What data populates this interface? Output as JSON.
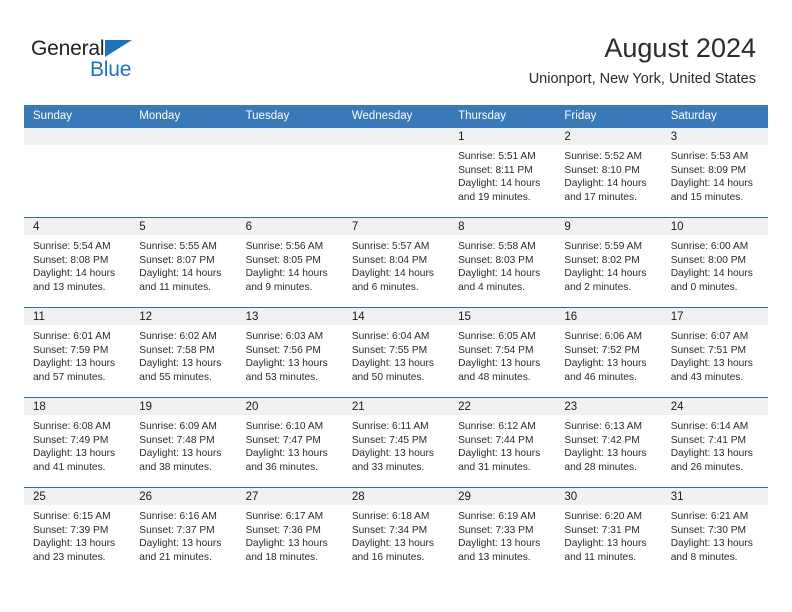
{
  "brand": {
    "name_top": "General",
    "name_bottom": "Blue",
    "triangle_color": "#1f72bd"
  },
  "header": {
    "title": "August 2024",
    "subtitle": "Unionport, New York, United States"
  },
  "theme": {
    "header_blue": "#3a79b8",
    "separator_blue": "#2e6da4",
    "daynum_band": "#f1f1f1"
  },
  "calendar": {
    "weekday_headers": [
      "Sunday",
      "Monday",
      "Tuesday",
      "Wednesday",
      "Thursday",
      "Friday",
      "Saturday"
    ],
    "weeks": [
      [
        {
          "day": "",
          "sunrise": "",
          "sunset": "",
          "daylight_line1": "",
          "daylight_line2": ""
        },
        {
          "day": "",
          "sunrise": "",
          "sunset": "",
          "daylight_line1": "",
          "daylight_line2": ""
        },
        {
          "day": "",
          "sunrise": "",
          "sunset": "",
          "daylight_line1": "",
          "daylight_line2": ""
        },
        {
          "day": "",
          "sunrise": "",
          "sunset": "",
          "daylight_line1": "",
          "daylight_line2": ""
        },
        {
          "day": "1",
          "sunrise": "Sunrise: 5:51 AM",
          "sunset": "Sunset: 8:11 PM",
          "daylight_line1": "Daylight: 14 hours",
          "daylight_line2": "and 19 minutes."
        },
        {
          "day": "2",
          "sunrise": "Sunrise: 5:52 AM",
          "sunset": "Sunset: 8:10 PM",
          "daylight_line1": "Daylight: 14 hours",
          "daylight_line2": "and 17 minutes."
        },
        {
          "day": "3",
          "sunrise": "Sunrise: 5:53 AM",
          "sunset": "Sunset: 8:09 PM",
          "daylight_line1": "Daylight: 14 hours",
          "daylight_line2": "and 15 minutes."
        }
      ],
      [
        {
          "day": "4",
          "sunrise": "Sunrise: 5:54 AM",
          "sunset": "Sunset: 8:08 PM",
          "daylight_line1": "Daylight: 14 hours",
          "daylight_line2": "and 13 minutes."
        },
        {
          "day": "5",
          "sunrise": "Sunrise: 5:55 AM",
          "sunset": "Sunset: 8:07 PM",
          "daylight_line1": "Daylight: 14 hours",
          "daylight_line2": "and 11 minutes."
        },
        {
          "day": "6",
          "sunrise": "Sunrise: 5:56 AM",
          "sunset": "Sunset: 8:05 PM",
          "daylight_line1": "Daylight: 14 hours",
          "daylight_line2": "and 9 minutes."
        },
        {
          "day": "7",
          "sunrise": "Sunrise: 5:57 AM",
          "sunset": "Sunset: 8:04 PM",
          "daylight_line1": "Daylight: 14 hours",
          "daylight_line2": "and 6 minutes."
        },
        {
          "day": "8",
          "sunrise": "Sunrise: 5:58 AM",
          "sunset": "Sunset: 8:03 PM",
          "daylight_line1": "Daylight: 14 hours",
          "daylight_line2": "and 4 minutes."
        },
        {
          "day": "9",
          "sunrise": "Sunrise: 5:59 AM",
          "sunset": "Sunset: 8:02 PM",
          "daylight_line1": "Daylight: 14 hours",
          "daylight_line2": "and 2 minutes."
        },
        {
          "day": "10",
          "sunrise": "Sunrise: 6:00 AM",
          "sunset": "Sunset: 8:00 PM",
          "daylight_line1": "Daylight: 14 hours",
          "daylight_line2": "and 0 minutes."
        }
      ],
      [
        {
          "day": "11",
          "sunrise": "Sunrise: 6:01 AM",
          "sunset": "Sunset: 7:59 PM",
          "daylight_line1": "Daylight: 13 hours",
          "daylight_line2": "and 57 minutes."
        },
        {
          "day": "12",
          "sunrise": "Sunrise: 6:02 AM",
          "sunset": "Sunset: 7:58 PM",
          "daylight_line1": "Daylight: 13 hours",
          "daylight_line2": "and 55 minutes."
        },
        {
          "day": "13",
          "sunrise": "Sunrise: 6:03 AM",
          "sunset": "Sunset: 7:56 PM",
          "daylight_line1": "Daylight: 13 hours",
          "daylight_line2": "and 53 minutes."
        },
        {
          "day": "14",
          "sunrise": "Sunrise: 6:04 AM",
          "sunset": "Sunset: 7:55 PM",
          "daylight_line1": "Daylight: 13 hours",
          "daylight_line2": "and 50 minutes."
        },
        {
          "day": "15",
          "sunrise": "Sunrise: 6:05 AM",
          "sunset": "Sunset: 7:54 PM",
          "daylight_line1": "Daylight: 13 hours",
          "daylight_line2": "and 48 minutes."
        },
        {
          "day": "16",
          "sunrise": "Sunrise: 6:06 AM",
          "sunset": "Sunset: 7:52 PM",
          "daylight_line1": "Daylight: 13 hours",
          "daylight_line2": "and 46 minutes."
        },
        {
          "day": "17",
          "sunrise": "Sunrise: 6:07 AM",
          "sunset": "Sunset: 7:51 PM",
          "daylight_line1": "Daylight: 13 hours",
          "daylight_line2": "and 43 minutes."
        }
      ],
      [
        {
          "day": "18",
          "sunrise": "Sunrise: 6:08 AM",
          "sunset": "Sunset: 7:49 PM",
          "daylight_line1": "Daylight: 13 hours",
          "daylight_line2": "and 41 minutes."
        },
        {
          "day": "19",
          "sunrise": "Sunrise: 6:09 AM",
          "sunset": "Sunset: 7:48 PM",
          "daylight_line1": "Daylight: 13 hours",
          "daylight_line2": "and 38 minutes."
        },
        {
          "day": "20",
          "sunrise": "Sunrise: 6:10 AM",
          "sunset": "Sunset: 7:47 PM",
          "daylight_line1": "Daylight: 13 hours",
          "daylight_line2": "and 36 minutes."
        },
        {
          "day": "21",
          "sunrise": "Sunrise: 6:11 AM",
          "sunset": "Sunset: 7:45 PM",
          "daylight_line1": "Daylight: 13 hours",
          "daylight_line2": "and 33 minutes."
        },
        {
          "day": "22",
          "sunrise": "Sunrise: 6:12 AM",
          "sunset": "Sunset: 7:44 PM",
          "daylight_line1": "Daylight: 13 hours",
          "daylight_line2": "and 31 minutes."
        },
        {
          "day": "23",
          "sunrise": "Sunrise: 6:13 AM",
          "sunset": "Sunset: 7:42 PM",
          "daylight_line1": "Daylight: 13 hours",
          "daylight_line2": "and 28 minutes."
        },
        {
          "day": "24",
          "sunrise": "Sunrise: 6:14 AM",
          "sunset": "Sunset: 7:41 PM",
          "daylight_line1": "Daylight: 13 hours",
          "daylight_line2": "and 26 minutes."
        }
      ],
      [
        {
          "day": "25",
          "sunrise": "Sunrise: 6:15 AM",
          "sunset": "Sunset: 7:39 PM",
          "daylight_line1": "Daylight: 13 hours",
          "daylight_line2": "and 23 minutes."
        },
        {
          "day": "26",
          "sunrise": "Sunrise: 6:16 AM",
          "sunset": "Sunset: 7:37 PM",
          "daylight_line1": "Daylight: 13 hours",
          "daylight_line2": "and 21 minutes."
        },
        {
          "day": "27",
          "sunrise": "Sunrise: 6:17 AM",
          "sunset": "Sunset: 7:36 PM",
          "daylight_line1": "Daylight: 13 hours",
          "daylight_line2": "and 18 minutes."
        },
        {
          "day": "28",
          "sunrise": "Sunrise: 6:18 AM",
          "sunset": "Sunset: 7:34 PM",
          "daylight_line1": "Daylight: 13 hours",
          "daylight_line2": "and 16 minutes."
        },
        {
          "day": "29",
          "sunrise": "Sunrise: 6:19 AM",
          "sunset": "Sunset: 7:33 PM",
          "daylight_line1": "Daylight: 13 hours",
          "daylight_line2": "and 13 minutes."
        },
        {
          "day": "30",
          "sunrise": "Sunrise: 6:20 AM",
          "sunset": "Sunset: 7:31 PM",
          "daylight_line1": "Daylight: 13 hours",
          "daylight_line2": "and 11 minutes."
        },
        {
          "day": "31",
          "sunrise": "Sunrise: 6:21 AM",
          "sunset": "Sunset: 7:30 PM",
          "daylight_line1": "Daylight: 13 hours",
          "daylight_line2": "and 8 minutes."
        }
      ]
    ]
  }
}
